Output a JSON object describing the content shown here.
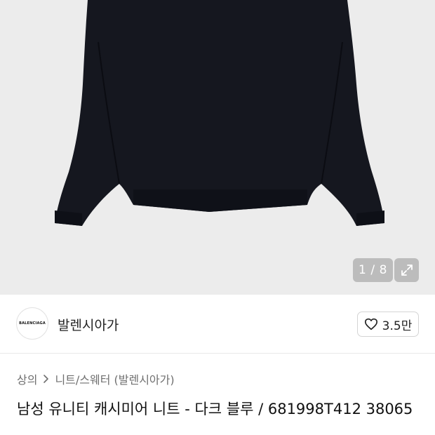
{
  "gallery": {
    "current_page": "1",
    "page_separator": "/",
    "total_pages": "8",
    "product_image": "dark navy cashmere knit sweater",
    "expand_icon": "expand-arrows-icon"
  },
  "brand": {
    "logo_text": "BALENCIAGA",
    "name": "발렌시아가",
    "like_count": "3.5만",
    "like_icon": "heart-outline-icon"
  },
  "breadcrumb": {
    "items": [
      "상의",
      "니트/스웨터 (발렌시아가)"
    ],
    "separator_icon": "chevron-right-icon"
  },
  "product": {
    "title": "남성 유니티 캐시미어 니트 - 다크 블루 / 681998T412 38065"
  },
  "colors": {
    "gallery_background": "#ececec",
    "sweater": "#15171f",
    "overlay": "#969696"
  }
}
